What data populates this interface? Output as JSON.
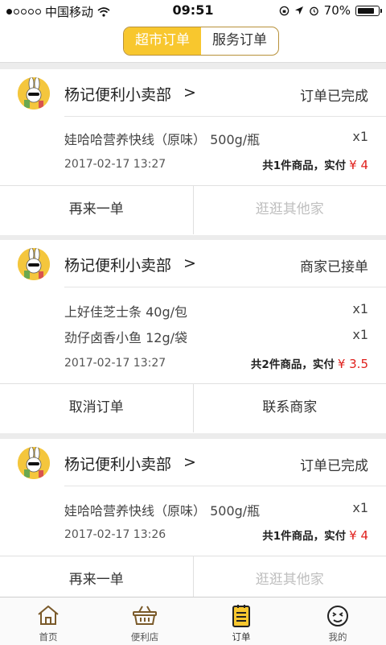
{
  "status_bar": {
    "carrier": "中国移动",
    "time": "09:51",
    "battery": "70%",
    "battery_level": 0.7
  },
  "segment": {
    "tabs": [
      {
        "label": "超市订单",
        "active": true
      },
      {
        "label": "服务订单",
        "active": false
      }
    ]
  },
  "orders": [
    {
      "shop": "杨记便利小卖部",
      "chevron": ">",
      "status": "订单已完成",
      "items": [
        {
          "name": "娃哈哈营养快线（原味） 500g/瓶",
          "qty": "x1"
        }
      ],
      "time": "2017-02-17 13:27",
      "summary": "共1件商品，实付",
      "amount": "¥ 4",
      "actions": [
        {
          "label": "再来一单",
          "enabled": true
        },
        {
          "label": "逛逛其他家",
          "enabled": false
        }
      ]
    },
    {
      "shop": "杨记便利小卖部",
      "chevron": ">",
      "status": "商家已接单",
      "items": [
        {
          "name": "上好佳芝士条 40g/包",
          "qty": "x1"
        },
        {
          "name": "劲仔卤香小鱼 12g/袋",
          "qty": "x1"
        }
      ],
      "time": "2017-02-17 13:27",
      "summary": "共2件商品，实付",
      "amount": "¥ 3.5",
      "actions": [
        {
          "label": "取消订单",
          "enabled": true
        },
        {
          "label": "联系商家",
          "enabled": true
        }
      ]
    },
    {
      "shop": "杨记便利小卖部",
      "chevron": ">",
      "status": "订单已完成",
      "items": [
        {
          "name": "娃哈哈营养快线（原味） 500g/瓶",
          "qty": "x1"
        }
      ],
      "time": "2017-02-17 13:26",
      "summary": "共1件商品，实付",
      "amount": "¥ 4",
      "actions": [
        {
          "label": "再来一单",
          "enabled": true
        },
        {
          "label": "逛逛其他家",
          "enabled": false
        }
      ]
    }
  ],
  "tabbar": {
    "tabs": [
      {
        "label": "首页",
        "icon": "home-icon"
      },
      {
        "label": "便利店",
        "icon": "basket-icon"
      },
      {
        "label": "订单",
        "icon": "order-list-icon",
        "active": true
      },
      {
        "label": "我的",
        "icon": "face-icon"
      }
    ]
  },
  "colors": {
    "accent": "#f8c72e",
    "price": "#e0201c",
    "segment_border": "#b8913a"
  }
}
